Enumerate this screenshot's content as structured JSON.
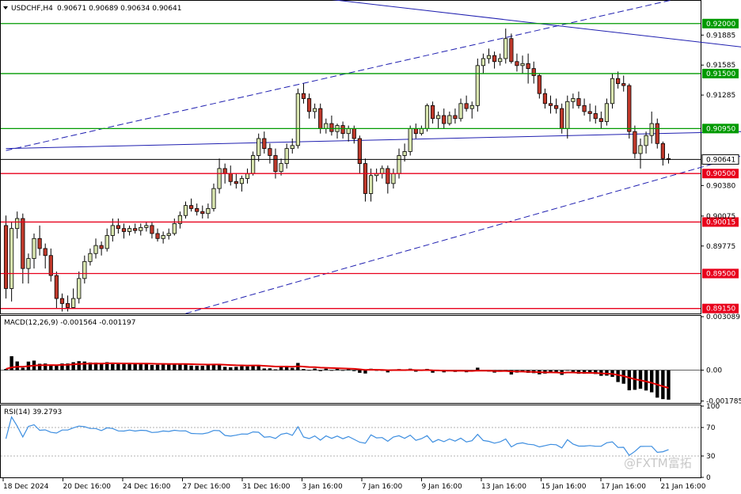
{
  "header": {
    "symbol": "USDCHF,H4",
    "quote": "0.90671 0.90689 0.90634 0.90641"
  },
  "watermark": "@FXTM富拓",
  "colors": {
    "bull": "#d9e6b0",
    "bear": "#c0392b",
    "support": "#e8001c",
    "resistance": "#009a00",
    "trend": "#1f1fb0",
    "macd_signal": "#e00000",
    "rsi_line": "#3d8ee0"
  },
  "chart_data": [
    {
      "type": "candlestick",
      "title": "USDCHF,H4",
      "ylim": [
        0.891,
        0.9222
      ],
      "price_ticks": [
        "0.91885",
        "0.91585",
        "0.91285",
        "0.90380",
        "0.90075",
        "0.89775"
      ],
      "levels": [
        {
          "value": 0.92,
          "label": "0.92000",
          "kind": "resistance"
        },
        {
          "value": 0.915,
          "label": "0.91500",
          "kind": "resistance"
        },
        {
          "value": 0.9095,
          "label": "0.90950",
          "kind": "resistance"
        },
        {
          "value": 0.90641,
          "label": "0.90641",
          "kind": "current"
        },
        {
          "value": 0.905,
          "label": "0.90500",
          "kind": "support"
        },
        {
          "value": 0.90015,
          "label": "0.90015",
          "kind": "support"
        },
        {
          "value": 0.895,
          "label": "0.89500",
          "kind": "support"
        },
        {
          "value": 0.8915,
          "label": "0.89150",
          "kind": "support"
        }
      ],
      "trendlines": [
        {
          "from": [
            0,
            0.9075
          ],
          "to": [
            209,
            0.9102
          ],
          "style": "solid"
        },
        {
          "from": [
            58,
            0.9224
          ],
          "to": [
            209,
            0.9126
          ],
          "style": "solid"
        },
        {
          "from": [
            0,
            0.9073
          ],
          "to": [
            126,
            0.9233
          ],
          "style": "dashed"
        },
        {
          "from": [
            32,
            0.891
          ],
          "to": [
            209,
            0.9192
          ],
          "style": "dashed"
        },
        {
          "from": [
            150,
            0.891
          ],
          "to": [
            209,
            0.8956
          ],
          "style": "solid"
        }
      ],
      "candles": [
        [
          0.8998,
          0.9008,
          0.8925,
          0.8935
        ],
        [
          0.8935,
          0.9002,
          0.8922,
          0.8995
        ],
        [
          0.8995,
          0.9012,
          0.8985,
          0.9005
        ],
        [
          0.9005,
          0.901,
          0.894,
          0.8955
        ],
        [
          0.8955,
          0.897,
          0.894,
          0.8965
        ],
        [
          0.8965,
          0.899,
          0.8955,
          0.8985
        ],
        [
          0.8985,
          0.8998,
          0.8968,
          0.8975
        ],
        [
          0.8975,
          0.898,
          0.8955,
          0.8968
        ],
        [
          0.8968,
          0.8975,
          0.8942,
          0.8948
        ],
        [
          0.8948,
          0.8952,
          0.8915,
          0.8925
        ],
        [
          0.8925,
          0.893,
          0.8912,
          0.892
        ],
        [
          0.892,
          0.8928,
          0.8912,
          0.8916
        ],
        [
          0.8916,
          0.8935,
          0.8915,
          0.8925
        ],
        [
          0.8925,
          0.8952,
          0.892,
          0.8945
        ],
        [
          0.8945,
          0.8968,
          0.894,
          0.8962
        ],
        [
          0.8962,
          0.8975,
          0.8958,
          0.897
        ],
        [
          0.897,
          0.8985,
          0.8965,
          0.8978
        ],
        [
          0.8978,
          0.8982,
          0.8968,
          0.8975
        ],
        [
          0.8975,
          0.8995,
          0.8972,
          0.8988
        ],
        [
          0.8988,
          0.9005,
          0.8982,
          0.8998
        ],
        [
          0.8998,
          0.9005,
          0.899,
          0.8995
        ],
        [
          0.8995,
          0.9,
          0.8985,
          0.8992
        ],
        [
          0.8992,
          0.8998,
          0.8988,
          0.8995
        ],
        [
          0.8995,
          0.9,
          0.899,
          0.8993
        ],
        [
          0.8993,
          0.9,
          0.8988,
          0.8996
        ],
        [
          0.8996,
          0.9002,
          0.8992,
          0.8998
        ],
        [
          0.8998,
          0.9002,
          0.8985,
          0.899
        ],
        [
          0.899,
          0.8995,
          0.8982,
          0.8985
        ],
        [
          0.8985,
          0.8992,
          0.898,
          0.8988
        ],
        [
          0.8988,
          0.8995,
          0.8984,
          0.899
        ],
        [
          0.899,
          0.9005,
          0.8988,
          0.9
        ],
        [
          0.9,
          0.9012,
          0.8995,
          0.9008
        ],
        [
          0.9008,
          0.9022,
          0.9005,
          0.9018
        ],
        [
          0.9018,
          0.9025,
          0.9012,
          0.9015
        ],
        [
          0.9015,
          0.902,
          0.9008,
          0.9012
        ],
        [
          0.9012,
          0.9018,
          0.9005,
          0.901
        ],
        [
          0.901,
          0.902,
          0.9005,
          0.9015
        ],
        [
          0.9015,
          0.904,
          0.9012,
          0.9035
        ],
        [
          0.9035,
          0.9065,
          0.903,
          0.9055
        ],
        [
          0.9055,
          0.906,
          0.904,
          0.905
        ],
        [
          0.905,
          0.9058,
          0.9038,
          0.9042
        ],
        [
          0.9042,
          0.905,
          0.9035,
          0.904
        ],
        [
          0.904,
          0.9048,
          0.9032,
          0.9045
        ],
        [
          0.9045,
          0.9055,
          0.904,
          0.905
        ],
        [
          0.905,
          0.9072,
          0.9048,
          0.9068
        ],
        [
          0.9068,
          0.909,
          0.9062,
          0.9085
        ],
        [
          0.9085,
          0.9092,
          0.907,
          0.9075
        ],
        [
          0.9075,
          0.908,
          0.906,
          0.9068
        ],
        [
          0.9068,
          0.9075,
          0.9045,
          0.9052
        ],
        [
          0.9052,
          0.9065,
          0.9048,
          0.906
        ],
        [
          0.906,
          0.908,
          0.9055,
          0.9075
        ],
        [
          0.9075,
          0.9085,
          0.907,
          0.9078
        ],
        [
          0.9078,
          0.9135,
          0.9075,
          0.913
        ],
        [
          0.913,
          0.914,
          0.912,
          0.9125
        ],
        [
          0.9125,
          0.913,
          0.9105,
          0.9112
        ],
        [
          0.9112,
          0.912,
          0.9105,
          0.9115
        ],
        [
          0.9115,
          0.912,
          0.909,
          0.9095
        ],
        [
          0.9095,
          0.9105,
          0.909,
          0.91
        ],
        [
          0.91,
          0.9108,
          0.9088,
          0.9092
        ],
        [
          0.9092,
          0.91,
          0.9085,
          0.9098
        ],
        [
          0.9098,
          0.9102,
          0.9085,
          0.909
        ],
        [
          0.909,
          0.9098,
          0.9082,
          0.9095
        ],
        [
          0.9095,
          0.9098,
          0.908,
          0.9085
        ],
        [
          0.9085,
          0.9088,
          0.905,
          0.906
        ],
        [
          0.906,
          0.9065,
          0.9022,
          0.903
        ],
        [
          0.903,
          0.9055,
          0.9022,
          0.9048
        ],
        [
          0.9048,
          0.9055,
          0.9042,
          0.905
        ],
        [
          0.905,
          0.9058,
          0.9045,
          0.9055
        ],
        [
          0.9055,
          0.9058,
          0.903,
          0.904
        ],
        [
          0.904,
          0.9055,
          0.9035,
          0.905
        ],
        [
          0.905,
          0.9075,
          0.9045,
          0.9068
        ],
        [
          0.9068,
          0.908,
          0.9062,
          0.9072
        ],
        [
          0.9072,
          0.9098,
          0.9068,
          0.9095
        ],
        [
          0.9095,
          0.91,
          0.9085,
          0.909
        ],
        [
          0.909,
          0.9098,
          0.9088,
          0.9095
        ],
        [
          0.9095,
          0.912,
          0.9092,
          0.9118
        ],
        [
          0.9118,
          0.9122,
          0.91,
          0.9105
        ],
        [
          0.9105,
          0.9112,
          0.9095,
          0.9108
        ],
        [
          0.9108,
          0.9115,
          0.9095,
          0.91
        ],
        [
          0.91,
          0.9112,
          0.9098,
          0.9108
        ],
        [
          0.9108,
          0.9115,
          0.91,
          0.9105
        ],
        [
          0.9105,
          0.9125,
          0.9102,
          0.912
        ],
        [
          0.912,
          0.9128,
          0.9112,
          0.9115
        ],
        [
          0.9115,
          0.9122,
          0.9105,
          0.9118
        ],
        [
          0.9118,
          0.9165,
          0.9112,
          0.9158
        ],
        [
          0.9158,
          0.917,
          0.915,
          0.9165
        ],
        [
          0.9165,
          0.9175,
          0.916,
          0.9168
        ],
        [
          0.9168,
          0.9172,
          0.9155,
          0.9162
        ],
        [
          0.9162,
          0.917,
          0.9158,
          0.9165
        ],
        [
          0.9165,
          0.9195,
          0.916,
          0.9185
        ],
        [
          0.9185,
          0.919,
          0.916,
          0.9162
        ],
        [
          0.9162,
          0.917,
          0.9152,
          0.9158
        ],
        [
          0.9158,
          0.9168,
          0.915,
          0.916
        ],
        [
          0.916,
          0.917,
          0.914,
          0.9155
        ],
        [
          0.9155,
          0.9162,
          0.914,
          0.9148
        ],
        [
          0.9148,
          0.915,
          0.9125,
          0.913
        ],
        [
          0.913,
          0.9135,
          0.9115,
          0.912
        ],
        [
          0.912,
          0.9128,
          0.911,
          0.9118
        ],
        [
          0.9118,
          0.9125,
          0.911,
          0.9115
        ],
        [
          0.9115,
          0.912,
          0.909,
          0.9095
        ],
        [
          0.9095,
          0.9128,
          0.9085,
          0.9122
        ],
        [
          0.9122,
          0.913,
          0.9115,
          0.9125
        ],
        [
          0.9125,
          0.9132,
          0.9115,
          0.9118
        ],
        [
          0.9118,
          0.9125,
          0.9108,
          0.9112
        ],
        [
          0.9112,
          0.912,
          0.9102,
          0.911
        ],
        [
          0.911,
          0.9118,
          0.91,
          0.9105
        ],
        [
          0.9105,
          0.9112,
          0.9095,
          0.9102
        ],
        [
          0.9102,
          0.9125,
          0.9098,
          0.912
        ],
        [
          0.912,
          0.915,
          0.9115,
          0.9145
        ],
        [
          0.9145,
          0.9152,
          0.9135,
          0.914
        ],
        [
          0.914,
          0.9148,
          0.9132,
          0.9138
        ],
        [
          0.9138,
          0.914,
          0.9085,
          0.9092
        ],
        [
          0.9092,
          0.9098,
          0.9065,
          0.907
        ],
        [
          0.907,
          0.9085,
          0.9055,
          0.9078
        ],
        [
          0.9078,
          0.9092,
          0.907,
          0.9088
        ],
        [
          0.9088,
          0.9112,
          0.908,
          0.91
        ],
        [
          0.91,
          0.9105,
          0.9075,
          0.908
        ],
        [
          0.908,
          0.9082,
          0.9058,
          0.9065
        ],
        [
          0.9065,
          0.907,
          0.906,
          0.9064
        ]
      ],
      "series": [
        {
          "name": "MACD(12,26,9)",
          "values": [
            0.00045,
            0.0004,
            0.00035,
            0.00022,
            0.0001,
            -3e-05,
            -8e-05,
            -0.00012,
            -0.00018,
            -0.0017
          ]
        },
        {
          "name": "RSI(14)",
          "values": [
            70,
            67,
            65,
            60,
            58,
            55,
            52,
            48,
            45,
            39.2793
          ]
        }
      ]
    },
    {
      "type": "bar",
      "title": "MACD(12,26,9) -0.001564 -0.001197",
      "ylim": [
        -0.00185,
        0.00309
      ],
      "ticks": [
        "0.003089",
        "0.00",
        "-0.001785"
      ]
    },
    {
      "type": "line",
      "title": "RSI(14) 39.2793",
      "ylim": [
        0,
        100
      ],
      "ticks": [
        "100",
        "70",
        "30",
        "0"
      ]
    }
  ],
  "x_axis": {
    "labels": [
      "18 Dec 2024",
      "20 Dec 16:00",
      "24 Dec 16:00",
      "27 Dec 16:00",
      "31 Dec 16:00",
      "3 Jan 16:00",
      "7 Jan 16:00",
      "9 Jan 16:00",
      "13 Jan 16:00",
      "15 Jan 16:00",
      "17 Jan 16:00",
      "21 Jan 16:00"
    ]
  }
}
